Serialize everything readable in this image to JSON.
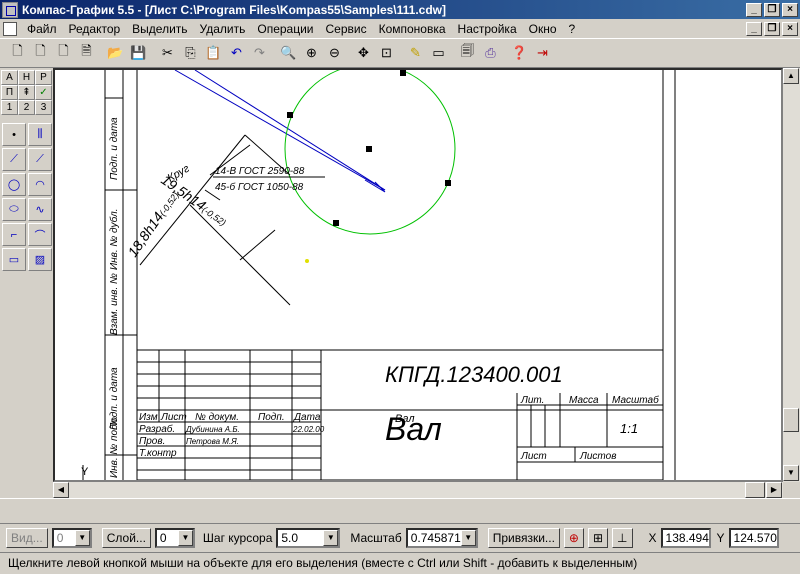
{
  "window": {
    "title": "Компас-График 5.5 - [Лист C:\\Program Files\\Kompas55\\Samples\\111.cdw]"
  },
  "menu": [
    "Файл",
    "Редактор",
    "Выделить",
    "Удалить",
    "Операции",
    "Сервис",
    "Компоновка",
    "Настройка",
    "Окно",
    "?"
  ],
  "toolbar_icons": [
    "new-doc-icon",
    "new-sheet-icon",
    "new-fragment-icon",
    "new-text-icon",
    "open-icon",
    "save-icon",
    "cut-icon",
    "copy-icon",
    "paste-icon",
    "undo-icon",
    "redo-icon",
    "zoom-icon",
    "zoom-in-icon",
    "zoom-out-icon",
    "pan-icon",
    "zoom-fit-icon",
    "edit-icon",
    "view-icon",
    "preview-icon",
    "print-icon",
    "help-icon",
    "exit-icon"
  ],
  "left_panel": {
    "row1": [
      "А",
      "Н",
      "Р"
    ],
    "row2": [
      "П",
      "⇞",
      "✓"
    ],
    "row3": [
      "1",
      "2",
      "3"
    ]
  },
  "drawing": {
    "side_labels": [
      "Подп. и дата",
      "Инв. № дубл.",
      "Взам. инв. №",
      "Подп. и дата",
      "Инв. № подл."
    ],
    "title": "КПГД.123400.001",
    "part_name": "Вал",
    "part_name_small": "Вал",
    "headers": [
      "Изм",
      "Лист",
      "№ докум.",
      "Подп.",
      "Дата"
    ],
    "rows": [
      {
        "role": "Разраб.",
        "name": "Дубинина А.Б.",
        "date": "22.02.00"
      },
      {
        "role": "Пров.",
        "name": "Петрова М.Я.",
        "date": ""
      },
      {
        "role": "Т.контр",
        "name": "",
        "date": ""
      }
    ],
    "lit_header": "Лит.",
    "mass_header": "Масса",
    "scale_header": "Масштаб",
    "scale_value": "1:1",
    "sheet_label": "Лист",
    "sheets_label": "Листов",
    "dim1": "18,8h14",
    "dim1_tol": "(-0,52)",
    "dim2": "19,5h14",
    "dim2_tol": "(-0,52)",
    "circle_label": "Круг",
    "gost1": "14-В ГОСТ 2590-88",
    "gost2": "45-б ГОСТ 1050-88"
  },
  "status": {
    "vid_label": "Вид...",
    "vid_value": "0",
    "layer_label": "Слой...",
    "layer_value": "0",
    "step_label": "Шаг курсора",
    "step_value": "5.0",
    "scale_label": "Масштаб",
    "scale_value": "0.745871",
    "snap_label": "Привязки...",
    "x_label": "X",
    "x_value": "138.494",
    "y_label": "Y",
    "y_value": "124.570",
    "message": "Щелкните левой кнопкой мыши на объекте для его выделения (вместе с Ctrl или Shift - добавить к выделенным)"
  },
  "colors": {
    "title_bar": "#0a246a",
    "circle": "#00c000",
    "drawing_lines": "#0000c0"
  }
}
